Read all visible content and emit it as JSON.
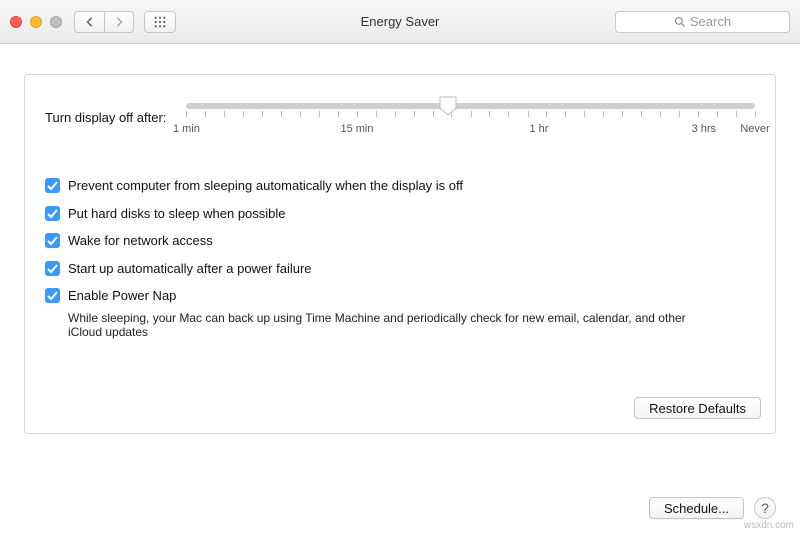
{
  "window": {
    "title": "Energy Saver",
    "search_placeholder": "Search"
  },
  "slider": {
    "label": "Turn display off after:",
    "value_percent": 46,
    "tick_labels": {
      "min1": "1 min",
      "min15": "15 min",
      "hr1": "1 hr",
      "hr3": "3 hrs",
      "never": "Never"
    }
  },
  "checkboxes": {
    "prevent_sleep": {
      "checked": true,
      "label": "Prevent computer from sleeping automatically when the display is off"
    },
    "hard_disks": {
      "checked": true,
      "label": "Put hard disks to sleep when possible"
    },
    "wake_network": {
      "checked": true,
      "label": "Wake for network access"
    },
    "startup_power_fail": {
      "checked": true,
      "label": "Start up automatically after a power failure"
    },
    "power_nap": {
      "checked": true,
      "label": "Enable Power Nap"
    }
  },
  "power_nap_note": "While sleeping, your Mac can back up using Time Machine and periodically check for new email, calendar, and other iCloud updates",
  "buttons": {
    "restore_defaults": "Restore Defaults",
    "schedule": "Schedule...",
    "help": "?"
  },
  "watermark": "wsxdn.com"
}
